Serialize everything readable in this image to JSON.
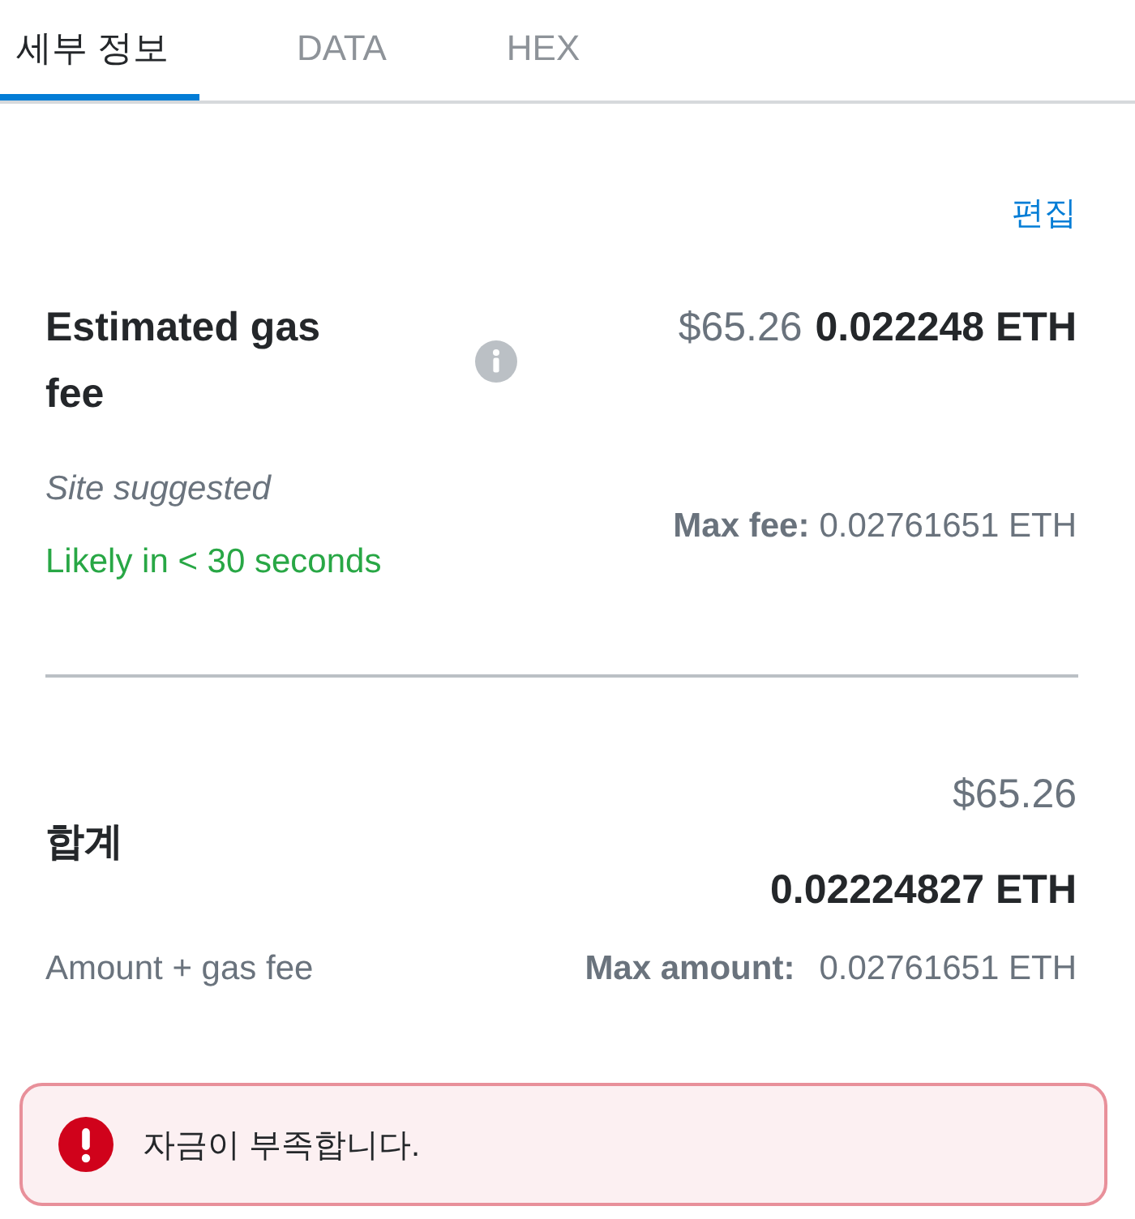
{
  "tabs": [
    {
      "label": "세부 정보",
      "selected": true
    },
    {
      "label": "DATA",
      "selected": false
    },
    {
      "label": "HEX",
      "selected": false
    }
  ],
  "edit_link": "편집",
  "gas_fee": {
    "label": "Estimated gas fee",
    "fiat": "$65.26",
    "eth": "0.022248 ETH",
    "source": "Site suggested",
    "timing": "Likely in < 30 seconds",
    "max_label": "Max fee:",
    "max_value": "0.02761651 ETH"
  },
  "total": {
    "label": "합계",
    "fiat": "$65.26",
    "eth": "0.02224827 ETH",
    "sublabel": "Amount + gas fee",
    "max_label": "Max amount:",
    "max_value": "0.02761651 ETH"
  },
  "alert": {
    "kind": "error",
    "message": "자금이 부족합니다."
  }
}
